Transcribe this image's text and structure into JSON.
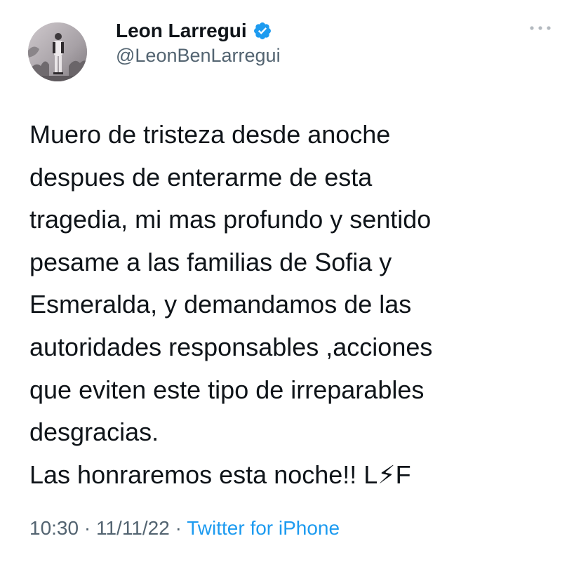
{
  "author": {
    "display_name": "Leon Larregui",
    "handle": "@LeonBenLarregui",
    "verified": true,
    "avatar_icon": "profile-photo",
    "verified_icon": "verified-badge-icon"
  },
  "more_icon": "more-options-icon",
  "tweet": {
    "text": "Muero de tristeza desde anoche\ndespues de enterarme de esta\ntragedia, mi mas profundo y sentido\npesame a las familias de Sofia y\nEsmeralda, y demandamos de las\nautoridades  responsables ,acciones\nque eviten este tipo de irreparables\ndesgracias.\nLas honraremos esta noche!!  L⚡F"
  },
  "meta": {
    "time": "10:30",
    "separator": "·",
    "date": "11/11/22",
    "source": "Twitter for iPhone"
  },
  "colors": {
    "text_primary": "#0f1419",
    "text_secondary": "#536471",
    "link": "#1d9bf0",
    "verified": "#1d9bf0",
    "background": "#ffffff"
  }
}
